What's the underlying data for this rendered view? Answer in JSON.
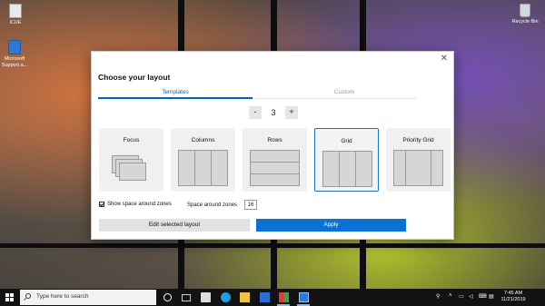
{
  "desktop": {
    "icons": [
      {
        "label": "iCUE"
      },
      {
        "label": "Microsoft Support a..."
      },
      {
        "label": "Recycle Bin"
      }
    ]
  },
  "dialog": {
    "title": "Choose your layout",
    "close_glyph": "✕",
    "tabs": [
      {
        "label": "Templates",
        "active": true
      },
      {
        "label": "Custom",
        "active": false
      }
    ],
    "zone_count": {
      "minus": "-",
      "value": "3",
      "plus": "+"
    },
    "layouts": [
      {
        "label": "Focus",
        "icon": "focus-layout-preview",
        "selected": false
      },
      {
        "label": "Columns",
        "icon": "columns-layout-preview",
        "selected": false
      },
      {
        "label": "Rows",
        "icon": "rows-layout-preview",
        "selected": false
      },
      {
        "label": "Grid",
        "icon": "grid-layout-preview",
        "selected": true
      },
      {
        "label": "Priority Grid",
        "icon": "priority-grid-layout-preview",
        "selected": false
      }
    ],
    "show_space": {
      "label": "Show space around zones",
      "checked": true
    },
    "space_around": {
      "label": "Space around zones",
      "value": "16"
    },
    "edit_button": "Edit selected layout",
    "apply_button": "Apply",
    "accent_color": "#0a72d4"
  },
  "taskbar": {
    "search_placeholder": "Type here to search",
    "icons": [
      "windows-start-icon",
      "cortana-icon",
      "task-view-icon",
      "store-icon",
      "edge-icon",
      "file-explorer-icon",
      "mail-icon",
      "powertoys-icon",
      "app-icon"
    ],
    "tray": {
      "icons": [
        "people-icon",
        "chevron-up-icon",
        "network-icon",
        "volume-icon",
        "keyboard-icon",
        "language-icon"
      ]
    },
    "clock": {
      "time": "7:45 AM",
      "date": "11/21/2019"
    }
  }
}
